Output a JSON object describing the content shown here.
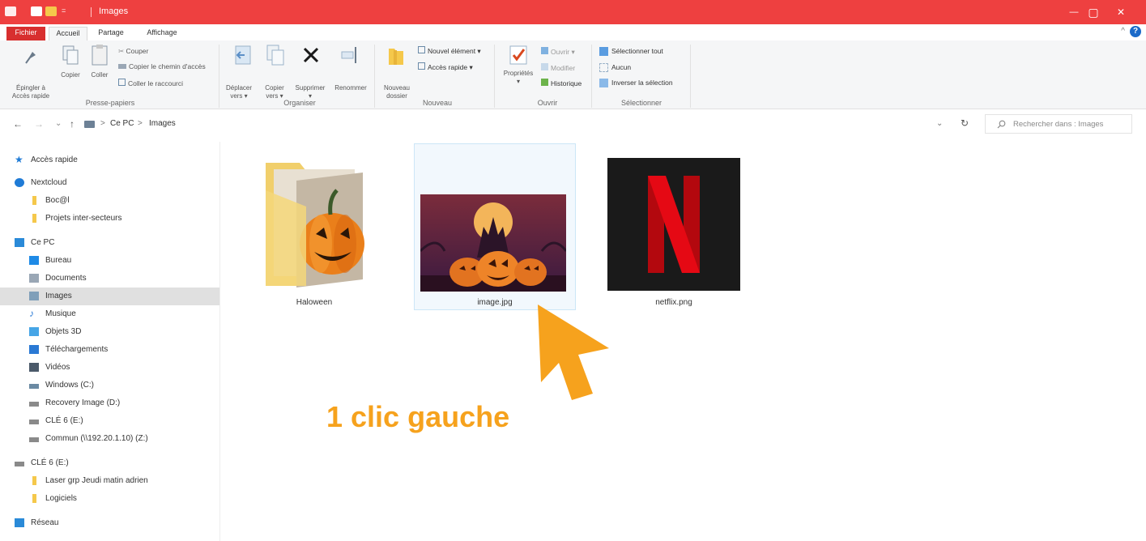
{
  "window": {
    "title": "Images",
    "min": "—",
    "max": "▢",
    "close": "✕"
  },
  "ribbon": {
    "tabs": [
      "Fichier",
      "Accueil",
      "Partage",
      "Affichage"
    ],
    "help": "?",
    "collapse": "^",
    "groups": {
      "clipboard": {
        "label": "Presse-papiers",
        "pin": "Épingler à\nAccès rapide",
        "copy": "Copier",
        "paste": "Coller",
        "cut": "Couper",
        "copy_path": "Copier le chemin d'accès",
        "paste_shortcut": "Coller le raccourci"
      },
      "organize": {
        "label": "Organiser",
        "move": "Déplacer\nvers ▾",
        "copyto": "Copier\nvers ▾",
        "delete": "Supprimer\n▾",
        "rename": "Renommer"
      },
      "new": {
        "label": "Nouveau",
        "new_folder": "Nouveau\ndossier",
        "new_item": "Nouvel élément ▾",
        "quick_access": "Accès rapide ▾"
      },
      "open": {
        "label": "Ouvrir",
        "properties": "Propriétés\n▾",
        "open": "Ouvrir ▾",
        "edit": "Modifier",
        "history": "Historique"
      },
      "select": {
        "label": "Sélectionner",
        "select_all": "Sélectionner tout",
        "none": "Aucun",
        "invert": "Inverser la sélection"
      }
    }
  },
  "address": {
    "back": "←",
    "forward": "→",
    "recent": "⌄",
    "up": "↑",
    "sep1": ">",
    "crumb1": "Ce PC",
    "sep2": ">",
    "crumb2": "Images",
    "dropdown": "⌄",
    "refresh": "↻",
    "search_placeholder": "Rechercher dans : Images"
  },
  "sidebar": {
    "items": [
      {
        "label": "Accès rapide",
        "icon": "star-icon",
        "color": "#1f7bd6"
      },
      {
        "label": "Nextcloud",
        "icon": "nextcloud-icon",
        "color": "#1f7bd6"
      },
      {
        "label": "Boc@l",
        "icon": "folder-icon",
        "color": "#f5c84b"
      },
      {
        "label": "Projets inter-secteurs",
        "icon": "folder-icon",
        "color": "#f5c84b"
      },
      {
        "label": "Ce PC",
        "icon": "computer-icon",
        "color": "#2a8ad8"
      },
      {
        "label": "Bureau",
        "icon": "desktop-icon",
        "color": "#1e8ae6"
      },
      {
        "label": "Documents",
        "icon": "documents-icon",
        "color": "#9aa7b5"
      },
      {
        "label": "Images",
        "icon": "pictures-icon",
        "color": "#7f9fb9"
      },
      {
        "label": "Musique",
        "icon": "music-icon",
        "color": "#2c7bd6"
      },
      {
        "label": "Objets 3D",
        "icon": "cube-icon",
        "color": "#46a5e6"
      },
      {
        "label": "Téléchargements",
        "icon": "download-icon",
        "color": "#2a79d4"
      },
      {
        "label": "Vidéos",
        "icon": "video-icon",
        "color": "#4b5a6a"
      },
      {
        "label": "Windows (C:)",
        "icon": "drive-icon",
        "color": "#6b8aa3"
      },
      {
        "label": "Recovery Image (D:)",
        "icon": "drive-icon",
        "color": "#8a8a8a"
      },
      {
        "label": "CLÉ 6 (E:)",
        "icon": "usb-icon",
        "color": "#8a8a8a"
      },
      {
        "label": "Commun (\\\\192.20.1.10) (Z:)",
        "icon": "network-drive-icon",
        "color": "#8a8a8a"
      },
      {
        "label": "CLÉ 6 (E:)",
        "icon": "usb-icon",
        "color": "#8a8a8a"
      },
      {
        "label": "Laser grp Jeudi matin adrien",
        "icon": "folder-icon",
        "color": "#f5c84b"
      },
      {
        "label": "Logiciels",
        "icon": "folder-icon",
        "color": "#f5c84b"
      },
      {
        "label": "Réseau",
        "icon": "network-icon",
        "color": "#2a8ad8"
      }
    ]
  },
  "files": [
    {
      "name": "Haloween",
      "kind": "folder"
    },
    {
      "name": "image.jpg",
      "kind": "image",
      "selected": true
    },
    {
      "name": "netflix.png",
      "kind": "image"
    }
  ],
  "annotation": {
    "text": "1 clic gauche",
    "color": "#f6a21d"
  }
}
